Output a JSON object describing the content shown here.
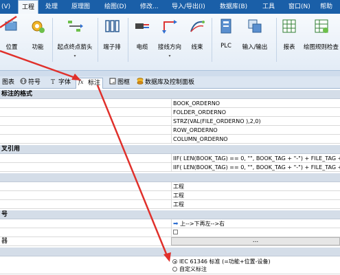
{
  "menubar": {
    "items": [
      "(V)",
      "工程",
      "处理",
      "原理图",
      "绘图(D)",
      "修改...",
      "导入/导出(I)",
      "数据库(B)",
      "工具",
      "窗口(N)",
      "帮助"
    ],
    "active": "工程"
  },
  "ribbon": {
    "buttons": [
      {
        "label": "位置",
        "icon": "location-icon"
      },
      {
        "label": "功能",
        "icon": "function-icon"
      },
      {
        "label": "起点终点箭头",
        "icon": "arrow-endpoints-icon",
        "dropdown": true
      },
      {
        "label": "端子排",
        "icon": "terminal-strip-icon"
      },
      {
        "label": "电缆",
        "icon": "cable-icon"
      },
      {
        "label": "接线方向",
        "icon": "wiring-direction-icon",
        "dropdown": true
      },
      {
        "label": "线束",
        "icon": "harness-icon"
      },
      {
        "label": "PLC",
        "icon": "plc-icon"
      },
      {
        "label": "输入/输出",
        "icon": "input-output-icon"
      },
      {
        "label": "报表",
        "icon": "report-icon"
      },
      {
        "label": "绘图规则检查",
        "icon": "drawing-rules-icon"
      }
    ]
  },
  "tabs": [
    {
      "label": "图表",
      "icon": ""
    },
    {
      "label": "符号",
      "icon": "symbol-icon"
    },
    {
      "label": "字体",
      "icon": "font-icon"
    },
    {
      "label": "标注",
      "icon": "fx-icon",
      "active": true
    },
    {
      "label": "图框",
      "icon": "frame-icon"
    },
    {
      "label": "数据库及控制面板",
      "icon": "database-icon"
    }
  ],
  "grid": {
    "section1_title": "标注的格式",
    "section1_values": [
      "BOOK_ORDERNO",
      "FOLDER_ORDERNO",
      "STRZ(VAL(FILE_ORDERNO ),2,0)",
      "ROW_ORDERNO",
      "COLUMN_ORDERNO"
    ],
    "section2_title": "叉引用",
    "section2_values": [
      "IIF( LEN(BOOK_TAG) == 0, \"\", BOOK_TAG + \"-\") + FILE_TAG +",
      "IIF( LEN(BOOK_TAG) == 0, \"\", BOOK_TAG + \"-\") + FILE_TAG +"
    ],
    "section3_values": [
      "工程",
      "工程",
      "工程"
    ],
    "section4_title": "号",
    "direction_value": "上-->下再左-->右",
    "editor_label": "器",
    "ellipsis": "...",
    "radio_iec": "IEC 61346 标准 (=功能+位置-设备)",
    "radio_custom": "自定义标注"
  },
  "colors": {
    "menubar": "#1a5fa8",
    "annotation_arrow": "#e0302b",
    "category_row": "#d4dde8"
  }
}
